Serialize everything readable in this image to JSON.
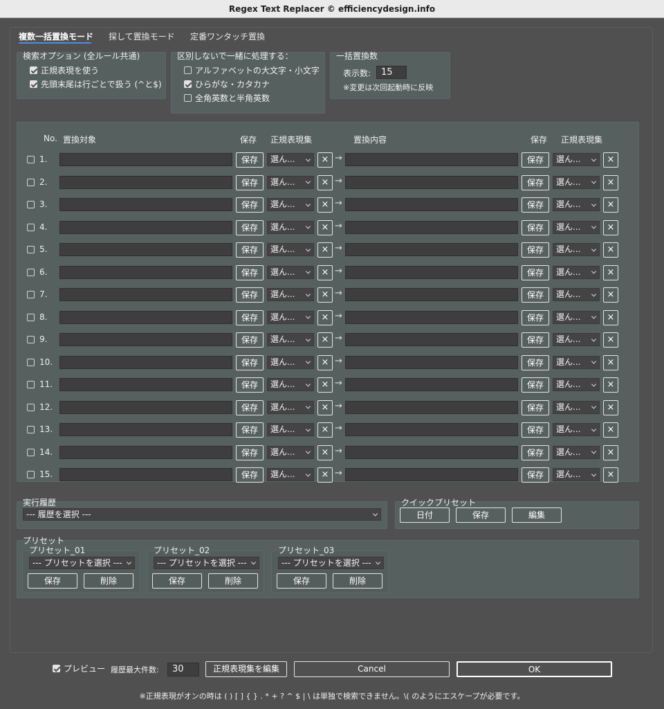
{
  "window": {
    "title": "Regex Text Replacer © efficiencydesign.info"
  },
  "tabs": [
    {
      "label": "複数一括置換モード",
      "active": true
    },
    {
      "label": "探して置換モード",
      "active": false
    },
    {
      "label": "定番ワンタッチ置換",
      "active": false
    }
  ],
  "search_options": {
    "title": "検索オプション (全ルール共通)",
    "items": [
      {
        "label": "正規表現を使う",
        "checked": true
      },
      {
        "label": "先頭末尾は行ごとで扱う (^と$)",
        "checked": true
      }
    ]
  },
  "case_options": {
    "title": "区別しないで一緒に処理する：",
    "items": [
      {
        "label": "アルファベットの大文字・小文字",
        "checked": false
      },
      {
        "label": "ひらがな・カタカナ",
        "checked": true
      },
      {
        "label": "全角英数と半角英数",
        "checked": false
      }
    ]
  },
  "bulk_count": {
    "title": "一括置換数",
    "label": "表示数:",
    "value": "15",
    "note": "※変更は次回起動時に反映"
  },
  "rules_table": {
    "headers": {
      "no": "No.",
      "target": "置換対象",
      "save": "保存",
      "regex_set": "正規表現集",
      "replacement": "置換内容",
      "save2": "保存",
      "regex_set2": "正規表現集"
    },
    "save_label": "保存",
    "select_label": "選ん...",
    "clear_label": "×",
    "arrow": "→",
    "rows": [
      {
        "no": "1."
      },
      {
        "no": "2."
      },
      {
        "no": "3."
      },
      {
        "no": "4."
      },
      {
        "no": "5."
      },
      {
        "no": "6."
      },
      {
        "no": "7."
      },
      {
        "no": "8."
      },
      {
        "no": "9."
      },
      {
        "no": "10."
      },
      {
        "no": "11."
      },
      {
        "no": "12."
      },
      {
        "no": "13."
      },
      {
        "no": "14."
      },
      {
        "no": "15."
      }
    ]
  },
  "history": {
    "title": "実行履歴",
    "selected": "--- 履歴を選択 ---"
  },
  "quick_preset": {
    "title": "クイックプリセット",
    "buttons": [
      "日付",
      "保存",
      "編集"
    ]
  },
  "presets": {
    "title": "プリセット",
    "groups": [
      {
        "name": "プリセット_01",
        "selected": "--- プリセットを選択 ---",
        "save": "保存",
        "delete": "削除"
      },
      {
        "name": "プリセット_02",
        "selected": "--- プリセットを選択 ---",
        "save": "保存",
        "delete": "削除"
      },
      {
        "name": "プリセット_03",
        "selected": "--- プリセットを選択 ---",
        "save": "保存",
        "delete": "削除"
      }
    ]
  },
  "footer": {
    "preview_label": "プレビュー",
    "preview_checked": true,
    "history_max_label": "履歴最大件数:",
    "history_max_value": "30",
    "edit_regex_label": "正規表現集を編集",
    "cancel_label": "Cancel",
    "ok_label": "OK",
    "note": "※正規表現がオンの時は ( ) [ ] { } . * + ? ^ $ | \\ は単独で検索できません。\\( のようにエスケープが必要です。"
  },
  "colors": {
    "accent": "#4b8fe0",
    "background": "#505050",
    "panel": "#56605f"
  }
}
